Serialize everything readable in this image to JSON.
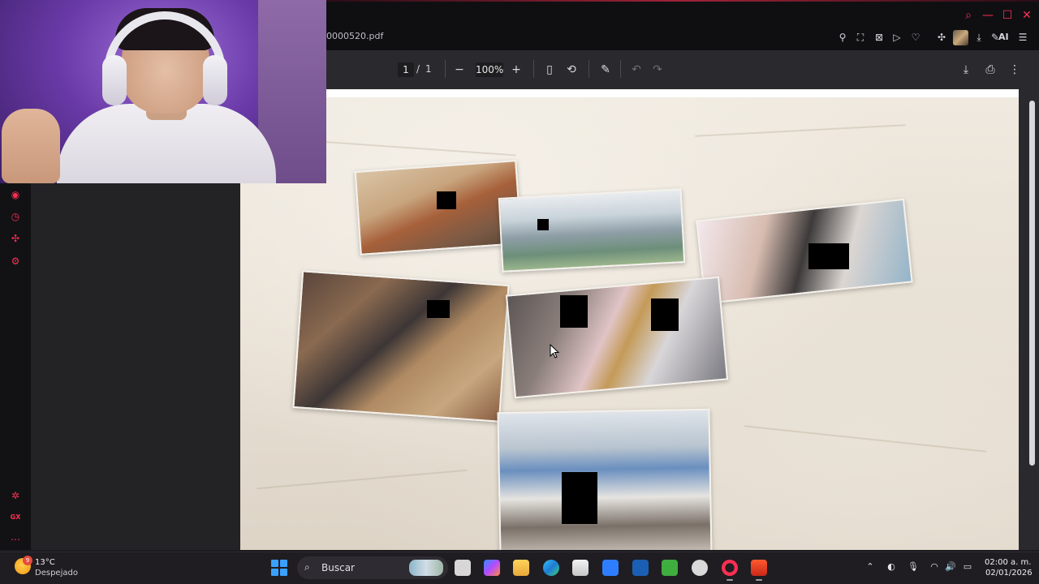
{
  "browser": {
    "tab_title": "0000520.pdf",
    "ai_label": "AI",
    "accent_color": "#ff2f52"
  },
  "pdf_toolbar": {
    "current_page": "1",
    "page_separator": "/",
    "total_pages": "1",
    "zoom": "100%",
    "icons": [
      "zoom-out-icon",
      "zoom-in-icon",
      "fit-page-icon",
      "rotate-icon",
      "annotate-icon",
      "undo-icon",
      "redo-icon",
      "download-icon",
      "print-icon",
      "more-icon"
    ]
  },
  "document": {
    "content": "photograph of printed photos laid on a bed with black redaction boxes"
  },
  "sidebar": {
    "icons": [
      "history-icon",
      "clock-icon",
      "extensions-icon",
      "settings-icon",
      "pinwheel-icon",
      "gx-icon",
      "more-icon"
    ],
    "gx_label": "GX"
  },
  "taskbar": {
    "weather_temp": "13°C",
    "weather_desc": "Despejado",
    "weather_badge": "9",
    "search_placeholder": "Buscar",
    "clock_time": "02:00 a. m.",
    "clock_date": "02/01/2026",
    "apps": [
      "file-icon",
      "copilot-icon",
      "file-explorer-icon",
      "edge-icon",
      "store-icon",
      "dropbox-icon",
      "app-icon",
      "minecraft-icon",
      "chatgpt-icon",
      "opera-gx-icon",
      "brave-icon"
    ]
  }
}
